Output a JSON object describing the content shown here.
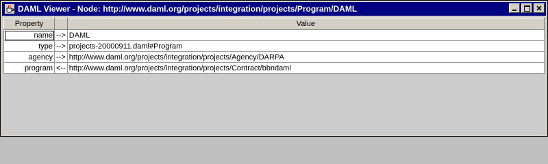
{
  "window": {
    "title": "DAML Viewer - Node: http://www.daml.org/projects/integration/projects/Program/DAML",
    "icon": "coffee-cup-icon",
    "buttons": [
      "minimize-icon",
      "maximize-icon",
      "close-icon"
    ]
  },
  "table": {
    "headers": {
      "property": "Property",
      "direction": "",
      "value": "Value"
    },
    "rows": [
      {
        "property": "name",
        "direction": "-->",
        "value": "DAML"
      },
      {
        "property": "type",
        "direction": "-->",
        "value": "projects-20000911.daml#Program"
      },
      {
        "property": "agency",
        "direction": "-->",
        "value": "http://www.daml.org/projects/integration/projects/Agency/DARPA"
      },
      {
        "property": "program",
        "direction": "<--",
        "value": "http://www.daml.org/projects/integration/projects/Contract/bbndaml"
      }
    ]
  }
}
